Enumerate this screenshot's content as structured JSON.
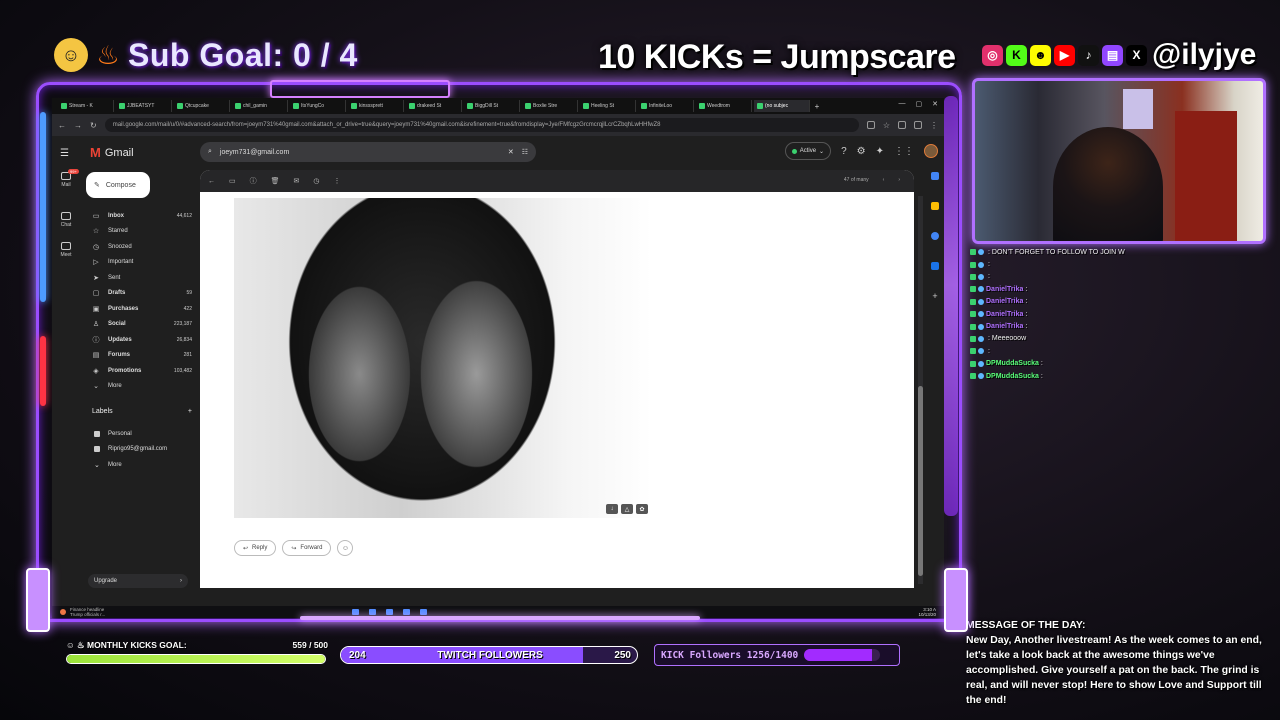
{
  "overlay": {
    "sub_goal": "Sub Goal:  0 / 4",
    "sub_goal_emoji": "sunglasses-emoji",
    "jumpscare": "10 KICKs = Jumpscare",
    "handle": "@ilyjye",
    "socials": [
      "instagram",
      "kick",
      "snapchat",
      "youtube",
      "tiktok",
      "twitch",
      "x"
    ]
  },
  "browser": {
    "tabs": [
      {
        "label": "Stream - K"
      },
      {
        "label": "JJBEATSYT"
      },
      {
        "label": "Qtcupcake"
      },
      {
        "label": "chil_gamin"
      },
      {
        "label": "ItsYungCo"
      },
      {
        "label": "kinsssprett"
      },
      {
        "label": "drakeed St"
      },
      {
        "label": "BiggDill St"
      },
      {
        "label": "Boxlie Stre"
      },
      {
        "label": "Heeling St"
      },
      {
        "label": "InfiniteLoo"
      },
      {
        "label": "Weedtrom"
      },
      {
        "label": "(no subjec"
      }
    ],
    "url": "mail.google.com/mail/u/0/#advanced-search/from=joeym731%40gmail.com&attach_or_drive=true&query=joeym731%40gmail.com&isrefinement=true&fromdisplay=Jye/FMfcgzGrcmcrqjlLcrCZbqhLwHHfwZ8"
  },
  "gmail": {
    "app_name": "Gmail",
    "search_value": "joeym731@gmail.com",
    "status": "Active",
    "compose": "Compose",
    "rail": [
      {
        "label": "Mail",
        "badge": "99+"
      },
      {
        "label": "Chat"
      },
      {
        "label": "Meet"
      }
    ],
    "folders": [
      {
        "icon": "inbox-icon",
        "glyph": "▭",
        "label": "Inbox",
        "count": "44,612",
        "bold": true
      },
      {
        "icon": "star-icon",
        "glyph": "☆",
        "label": "Starred",
        "count": ""
      },
      {
        "icon": "snooze-icon",
        "glyph": "◷",
        "label": "Snoozed",
        "count": ""
      },
      {
        "icon": "important-icon",
        "glyph": "▷",
        "label": "Important",
        "count": ""
      },
      {
        "icon": "send-icon",
        "glyph": "➤",
        "label": "Sent",
        "count": ""
      },
      {
        "icon": "draft-icon",
        "glyph": "▢",
        "label": "Drafts",
        "count": "59",
        "bold": true
      },
      {
        "icon": "purchases-icon",
        "glyph": "▣",
        "label": "Purchases",
        "count": "422",
        "bold": true
      },
      {
        "icon": "social-icon",
        "glyph": "♙",
        "label": "Social",
        "count": "223,187",
        "bold": true
      },
      {
        "icon": "updates-icon",
        "glyph": "ⓘ",
        "label": "Updates",
        "count": "26,834",
        "bold": true
      },
      {
        "icon": "forums-icon",
        "glyph": "▤",
        "label": "Forums",
        "count": "281",
        "bold": true
      },
      {
        "icon": "promotions-icon",
        "glyph": "◈",
        "label": "Promotions",
        "count": "103,482",
        "bold": true
      },
      {
        "icon": "chevron-down-icon",
        "glyph": "⌄",
        "label": "More",
        "count": ""
      }
    ],
    "labels_heading": "Labels",
    "labels": [
      {
        "label": "Personal"
      },
      {
        "label": "Riprigo95@gmail.com"
      },
      {
        "label": "More"
      }
    ],
    "upgrade": "Upgrade",
    "pager": "47 of many",
    "reply": "Reply",
    "forward": "Forward"
  },
  "taskbar": {
    "news_title": "Finance headline",
    "news_sub": "Trump officials r...",
    "time": "3:10 A",
    "date": "10/13/20"
  },
  "chat": [
    {
      "user": "",
      "message": ": DON'T FORGET TO FOLLOW TO JOIN W",
      "user_color": "#ff4a4a"
    },
    {
      "user": "",
      "message": ":",
      "user_color": "#ff5fa8"
    },
    {
      "user": "",
      "message": ":",
      "user_color": "#ff5fa8"
    },
    {
      "user": "DanielTrika",
      "message": ":",
      "user_color": "#b070ff"
    },
    {
      "user": "DanielTrika",
      "message": ":",
      "user_color": "#b070ff"
    },
    {
      "user": "DanielTrika",
      "message": ":",
      "user_color": "#b070ff"
    },
    {
      "user": "DanielTrika",
      "message": ":",
      "user_color": "#b070ff"
    },
    {
      "user": "",
      "message": ": Meeeooow",
      "user_color": "#ff4a4a"
    },
    {
      "user": "",
      "message": ":",
      "user_color": "#ff5fa8"
    },
    {
      "user": "DPMuddaSucka",
      "message": ":",
      "user_color": "#5aff7a"
    },
    {
      "user": "DPMuddaSucka",
      "message": ":",
      "user_color": "#5aff7a"
    }
  ],
  "motd": {
    "title": "MESSAGE OF THE DAY:",
    "text": "New Day, Another livestream! As the week comes to an end, let's take a look back at the awesome things we've accomplished. Give yourself a pat on the back. The grind is real, and will never stop! Here to show Love and Support till the end!"
  },
  "goals": {
    "kicks_label": "MONTHLY KICKS GOAL:",
    "kicks_value": "559 / 500",
    "kicks_progress": 1.0,
    "twitch_current": "204",
    "twitch_label": "TWITCH FOLLOWERS",
    "twitch_target": "250",
    "twitch_progress": 0.816,
    "kick_followers": "KICK Followers 1256/1400",
    "kick_progress": 0.897
  }
}
